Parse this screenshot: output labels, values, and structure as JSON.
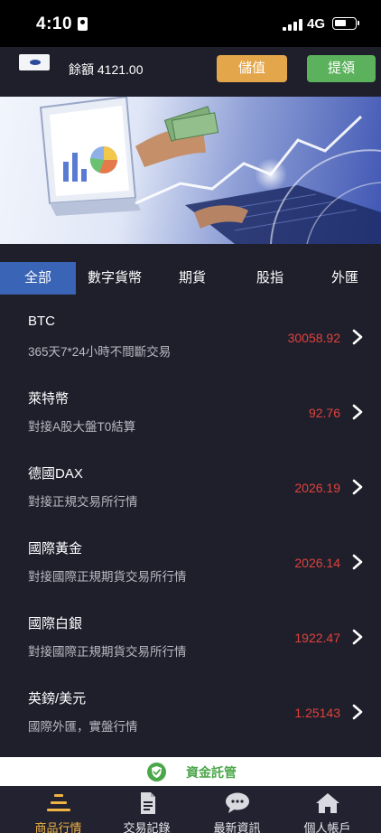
{
  "status_bar": {
    "time": "4:10",
    "network": "4G"
  },
  "header": {
    "balance_label": "餘額 4121.00",
    "deposit_label": "儲值",
    "withdraw_label": "提領"
  },
  "tabs": [
    {
      "label": "全部",
      "active": true
    },
    {
      "label": "數字貨幣",
      "active": false
    },
    {
      "label": "期貨",
      "active": false
    },
    {
      "label": "股指",
      "active": false
    },
    {
      "label": "外匯",
      "active": false
    }
  ],
  "products": [
    {
      "name": "BTC",
      "desc": "365天7*24小時不間斷交易",
      "price": "30058.92"
    },
    {
      "name": "萊特幣",
      "desc": "對接A股大盤T0結算",
      "price": "92.76"
    },
    {
      "name": "德國DAX",
      "desc": "對接正規交易所行情",
      "price": "2026.19"
    },
    {
      "name": "國際黃金",
      "desc": "對接國際正規期貨交易所行情",
      "price": "2026.14"
    },
    {
      "name": "國際白銀",
      "desc": "對接國際正規期貨交易所行情",
      "price": "1922.47"
    },
    {
      "name": "英鎊/美元",
      "desc": "國際外匯，實盤行情",
      "price": "1.25143"
    }
  ],
  "custody": {
    "label": "資金託管"
  },
  "bottom_nav": [
    {
      "label": "商品行情",
      "icon": "market-icon",
      "active": true
    },
    {
      "label": "交易記錄",
      "icon": "document-icon",
      "active": false
    },
    {
      "label": "最新資訊",
      "icon": "chat-icon",
      "active": false
    },
    {
      "label": "個人帳戶",
      "icon": "home-icon",
      "active": false
    }
  ],
  "colors": {
    "background": "#1f1f2c",
    "accent_gold": "#e4a64a",
    "accent_green": "#5bb15c",
    "price_red": "#e0423b",
    "tab_active": "#3a64b5"
  }
}
